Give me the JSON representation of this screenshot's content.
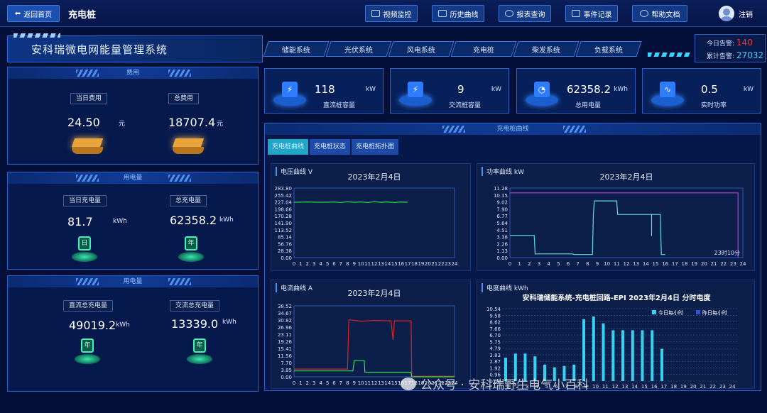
{
  "topbar": {
    "back_label": "返回首页",
    "page_name": "充电桩",
    "nav": [
      {
        "label": "视频监控"
      },
      {
        "label": "历史曲线"
      },
      {
        "label": "报表查询"
      },
      {
        "label": "事件记录"
      },
      {
        "label": "帮助文档"
      }
    ],
    "user_label": "注销"
  },
  "header": {
    "system_title": "安科瑞微电网能量管理系统",
    "tabs": [
      "储能系统",
      "光伏系统",
      "风电系统",
      "充电桩",
      "柴发系统",
      "负载系统"
    ],
    "alarm_today_label": "今日告警:",
    "alarm_today_value": "140",
    "alarm_total_label": "累计告警:",
    "alarm_total_value": "27032",
    "colors": {
      "alarm_today": "#ff3030",
      "alarm_total": "#38d4ff"
    }
  },
  "left": {
    "fee": {
      "title": "费用",
      "today_label": "当日费用",
      "today_value": "24.50",
      "today_unit": "元",
      "total_label": "总费用",
      "total_value": "18707.4",
      "total_unit": "元"
    },
    "usage": {
      "title": "用电量",
      "today_label": "当日充电量",
      "today_value": "81.7",
      "today_unit": "kWh",
      "total_label": "总充电量",
      "total_value": "62358.2",
      "total_unit": "kWh",
      "icon_char_day": "日",
      "icon_char_total": "年"
    },
    "usage2": {
      "title": "用电量",
      "dc_label": "直流总充电量",
      "dc_value": "49019.2",
      "dc_unit": "kWh",
      "ac_label": "交流总充电量",
      "ac_value": "13339.0",
      "ac_unit": "kWh",
      "icon_char": "年"
    }
  },
  "kpis": [
    {
      "value": "118",
      "unit": "kW",
      "label": "直流桩容量",
      "icon": "charger-icon"
    },
    {
      "value": "9",
      "unit": "kW",
      "label": "交流桩容量",
      "icon": "charger-icon"
    },
    {
      "value": "62358.2",
      "unit": "kWh",
      "label": "总用电量",
      "icon": "meter-icon"
    },
    {
      "value": "0.5",
      "unit": "kW",
      "label": "实时功率",
      "icon": "pulse-icon"
    }
  ],
  "main": {
    "title": "充电桩曲线",
    "subtabs": [
      "充电桩曲线",
      "充电桩状态",
      "充电桩拓扑图"
    ]
  },
  "chart_data": [
    {
      "type": "line",
      "panel_title": "电压曲线  V",
      "title": "2023年2月4日",
      "x": [
        0,
        1,
        2,
        3,
        4,
        5,
        6,
        7,
        8,
        9,
        10,
        11,
        12,
        13,
        14,
        15,
        16,
        17,
        18,
        19,
        20,
        21,
        22,
        23,
        24
      ],
      "yticks": [
        "283.80",
        "255.42",
        "227.04",
        "198.66",
        "170.28",
        "141.90",
        "113.52",
        "85.14",
        "56.76",
        "28.38",
        "0.00"
      ],
      "ylim": [
        0,
        283.8
      ],
      "series": [
        {
          "color": "#2ee04a",
          "points": [
            [
              0,
              226
            ],
            [
              2,
              227
            ],
            [
              4,
              226
            ],
            [
              6,
              227
            ],
            [
              7,
              225
            ],
            [
              8,
              228
            ],
            [
              9,
              226
            ],
            [
              10,
              227
            ],
            [
              11,
              225
            ],
            [
              12,
              228
            ],
            [
              13,
              226
            ],
            [
              14,
              227
            ],
            [
              15,
              225
            ],
            [
              16,
              227
            ],
            [
              17,
              226
            ]
          ]
        }
      ]
    },
    {
      "type": "line",
      "panel_title": "功率曲线  kW",
      "title": "2023年2月4日",
      "x": [
        0,
        1,
        2,
        3,
        4,
        5,
        6,
        7,
        8,
        9,
        10,
        11,
        12,
        13,
        14,
        15,
        16,
        17,
        18,
        19,
        20,
        21,
        22,
        23,
        24
      ],
      "yticks": [
        "11.28",
        "10.15",
        "9.02",
        "7.90",
        "6.77",
        "5.64",
        "4.51",
        "3.38",
        "2.26",
        "1.13",
        "0.00"
      ],
      "ylim": [
        0,
        11.28
      ],
      "annotation": "23时10分",
      "series": [
        {
          "color": "#c040e0",
          "points": [
            [
              0,
              10.5
            ],
            [
              23.5,
              10.5
            ],
            [
              23.5,
              0
            ]
          ]
        },
        {
          "color": "#5fd9e6",
          "points": [
            [
              0,
              3.6
            ],
            [
              2.5,
              3.6
            ],
            [
              2.6,
              0.6
            ],
            [
              6.5,
              0.6
            ],
            [
              6.6,
              0.5
            ],
            [
              8.5,
              0.5
            ],
            [
              8.6,
              7.0
            ],
            [
              8.7,
              9.2
            ],
            [
              11,
              9.2
            ],
            [
              11.1,
              7.0
            ],
            [
              15.5,
              7.0
            ],
            [
              15.6,
              0.5
            ],
            [
              16,
              0.5
            ]
          ]
        },
        {
          "color": "#5fd9e6",
          "points": [
            [
              14.6,
              7.0
            ],
            [
              14.6,
              3.5
            ]
          ]
        }
      ]
    },
    {
      "type": "line",
      "panel_title": "电流曲线  A",
      "title": "2023年2月4日",
      "x": [
        0,
        1,
        2,
        3,
        4,
        5,
        6,
        7,
        8,
        9,
        10,
        11,
        12,
        13,
        14,
        15,
        16,
        17,
        18,
        19,
        20,
        21,
        22,
        23,
        24
      ],
      "yticks": [
        "38.52",
        "34.67",
        "30.82",
        "26.96",
        "23.11",
        "19.26",
        "15.41",
        "11.56",
        "7.70",
        "3.85",
        "0.00"
      ],
      "ylim": [
        0,
        38.52
      ],
      "series": [
        {
          "color": "#e02020",
          "points": [
            [
              0,
              4.2
            ],
            [
              8,
              4.2
            ],
            [
              8.2,
              31
            ],
            [
              10,
              30.2
            ],
            [
              12,
              30.6
            ],
            [
              14.5,
              30.4
            ],
            [
              14.8,
              20
            ],
            [
              15,
              30.4
            ],
            [
              17.5,
              30.4
            ],
            [
              17.6,
              0.3
            ],
            [
              24,
              0.3
            ]
          ]
        },
        {
          "color": "#2ee04a",
          "points": [
            [
              0,
              3.2
            ],
            [
              8.8,
              3.2
            ],
            [
              9,
              8.8
            ],
            [
              10.5,
              8.8
            ],
            [
              10.6,
              2.5
            ],
            [
              17.5,
              2.5
            ],
            [
              17.6,
              0
            ],
            [
              24,
              0
            ]
          ]
        }
      ]
    },
    {
      "type": "bar",
      "panel_title": "电度曲线  kWh",
      "title": "安科瑞储能系统-充电桩回路-EPI 2023年2月4日 分时电度",
      "legend": [
        "今日每小时",
        "昨日每小时"
      ],
      "categories": [
        "1",
        "2",
        "3",
        "4",
        "5",
        "6",
        "7",
        "8",
        "9",
        "10",
        "11",
        "12",
        "13",
        "14",
        "15",
        "16",
        "17",
        "18",
        "19",
        "20",
        "21",
        "22",
        "23",
        "24"
      ],
      "yticks": [
        "10.54",
        "9.58",
        "8.62",
        "7.66",
        "6.70",
        "5.75",
        "4.79",
        "3.83",
        "2.87",
        "1.92",
        "0.96",
        "0.00"
      ],
      "ylim": [
        0,
        10.54
      ],
      "series": [
        {
          "name": "今日每小时",
          "color": "#36d2f2",
          "values": [
            3.4,
            4.0,
            4.0,
            3.6,
            2.4,
            2.0,
            2.2,
            2.4,
            9.0,
            9.4,
            8.4,
            7.4,
            7.4,
            7.4,
            7.4,
            7.4,
            4.7,
            0,
            0,
            0,
            0,
            0,
            0,
            0
          ]
        },
        {
          "name": "昨日每小时",
          "color": "#2b56d8",
          "values": [
            0,
            0,
            0,
            0,
            0,
            0,
            0,
            0,
            0,
            0,
            0,
            0,
            0,
            0,
            0,
            0,
            0,
            0,
            0,
            0,
            0,
            0,
            0,
            0
          ]
        }
      ]
    }
  ],
  "watermark": "公众号 · 安科瑞野生电气小百科"
}
